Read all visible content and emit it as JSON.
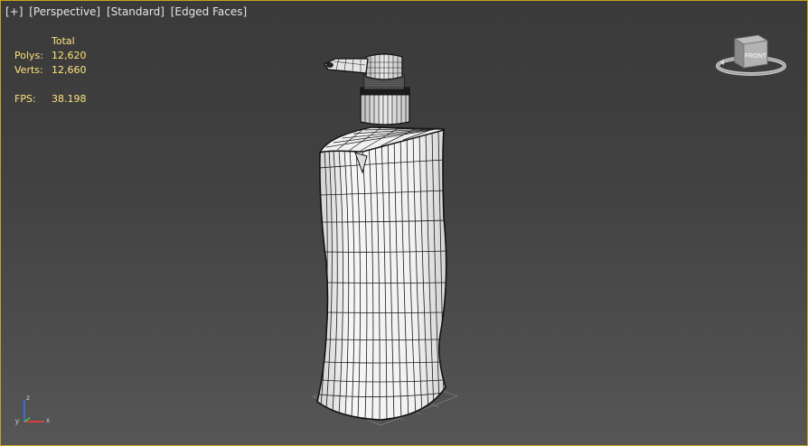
{
  "viewport": {
    "labels": {
      "menu": "[+]",
      "view": "[Perspective]",
      "shading": "[Standard]",
      "mode": "[Edged Faces]"
    },
    "stats": {
      "header": "Total",
      "polys_label": "Polys:",
      "polys_value": "12,620",
      "verts_label": "Verts:",
      "verts_value": "12,660",
      "fps_label": "FPS:",
      "fps_value": "38.198"
    },
    "viewcube": {
      "face_label": "FRONT"
    },
    "axis": {
      "x": "x",
      "y": "y",
      "z": "z"
    }
  },
  "colors": {
    "border_active": "#c8a21e",
    "stats_text": "#ffe27a",
    "wire": "#0a0a0a",
    "mesh_fill": "#ececec"
  }
}
